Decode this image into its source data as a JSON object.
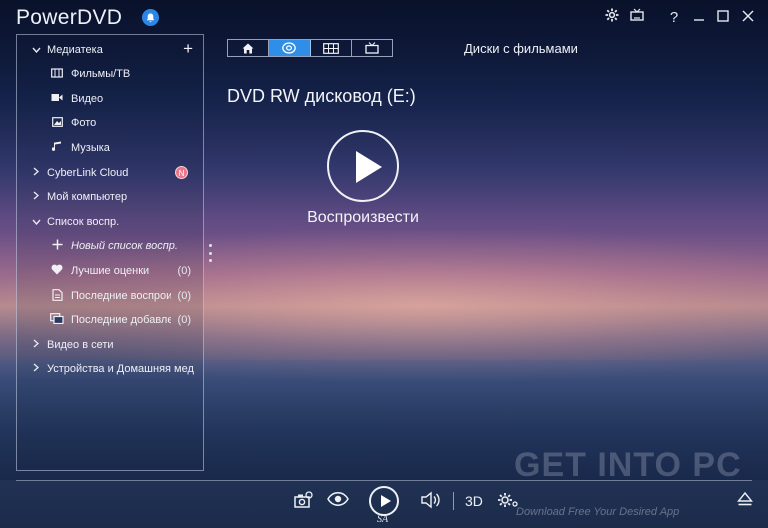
{
  "app": {
    "title": "PowerDVD"
  },
  "titlebar": {
    "notification_icon": "bell-icon",
    "controls": [
      "settings-icon",
      "tv-icon",
      "help-icon",
      "minimize-icon",
      "maximize-icon",
      "close-icon"
    ],
    "help_glyph": "?"
  },
  "sidebar": {
    "media_library": {
      "label": "Медиатека",
      "add_glyph": "+"
    },
    "items": [
      {
        "label": "Фильмы/ТВ",
        "icon": "film-icon"
      },
      {
        "label": "Видео",
        "icon": "video-camera-icon"
      },
      {
        "label": "Фото",
        "icon": "photo-icon"
      },
      {
        "label": "Музыка",
        "icon": "music-note-icon"
      }
    ],
    "cyberlink_cloud": {
      "label": "CyberLink Cloud",
      "badge": "N"
    },
    "my_computer": {
      "label": "Мой компьютер"
    },
    "playlists": {
      "label": "Список воспр."
    },
    "playlist_items": [
      {
        "label": "Новый список воспр.",
        "icon": "plus-icon",
        "count": ""
      },
      {
        "label": "Лучшие оценки",
        "icon": "heart-icon",
        "count": "(0)"
      },
      {
        "label": "Последние воспроизв",
        "icon": "recent-played-icon",
        "count": "(0)"
      },
      {
        "label": "Последние добавлени",
        "icon": "recent-added-icon",
        "count": "(0)"
      }
    ],
    "online_video": {
      "label": "Видео в сети"
    },
    "devices": {
      "label": "Устройства и Домашняя мед"
    }
  },
  "tabs": {
    "items": [
      "home-icon",
      "disc-icon",
      "film-strip-icon",
      "tv-icon"
    ],
    "active_index": 1
  },
  "main": {
    "section_title": "Диски с фильмами",
    "drive_title": "DVD RW дисковод (E:)",
    "play_label": "Воспроизвести"
  },
  "controls": {
    "three_d_label": "3D",
    "sa_label": "SA"
  },
  "watermark": {
    "main": "GET INTO PC",
    "sub": "Download Free Your Desired App"
  }
}
